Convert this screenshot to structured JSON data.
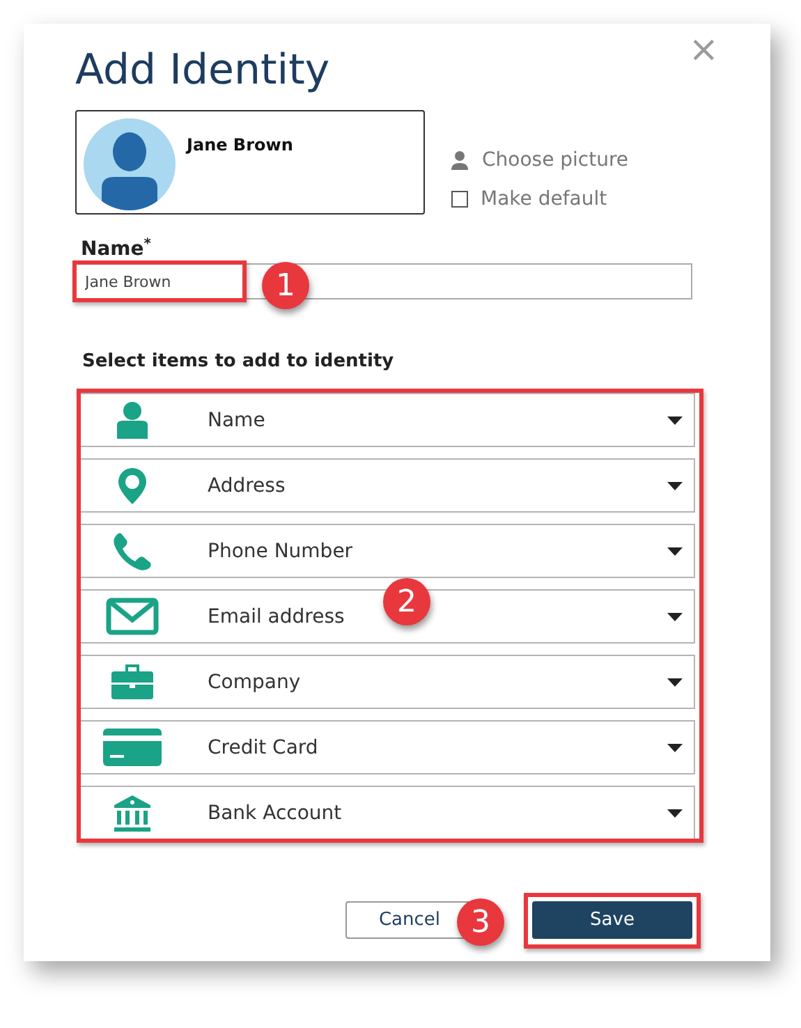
{
  "dialog": {
    "title": "Add Identity",
    "close": "×",
    "profile": {
      "name": "Jane Brown"
    },
    "choose_picture": "Choose picture",
    "make_default": {
      "label": "Make default",
      "checked": false
    },
    "name_field": {
      "label": "Name",
      "required_mark": "*",
      "value": "Jane Brown"
    },
    "items_heading": "Select items to add to identity",
    "items": [
      {
        "kind": "person",
        "label": "Name"
      },
      {
        "kind": "pin",
        "label": "Address"
      },
      {
        "kind": "phone",
        "label": "Phone Number"
      },
      {
        "kind": "mail",
        "label": "Email address"
      },
      {
        "kind": "briefcase",
        "label": "Company"
      },
      {
        "kind": "card",
        "label": "Credit Card"
      },
      {
        "kind": "bank",
        "label": "Bank Account"
      }
    ],
    "buttons": [
      {
        "kind": "secondary",
        "label": "Cancel"
      },
      {
        "kind": "primary",
        "label": "Save"
      }
    ]
  },
  "callouts": [
    {
      "label": "1"
    },
    {
      "label": "2"
    },
    {
      "label": "3"
    }
  ]
}
